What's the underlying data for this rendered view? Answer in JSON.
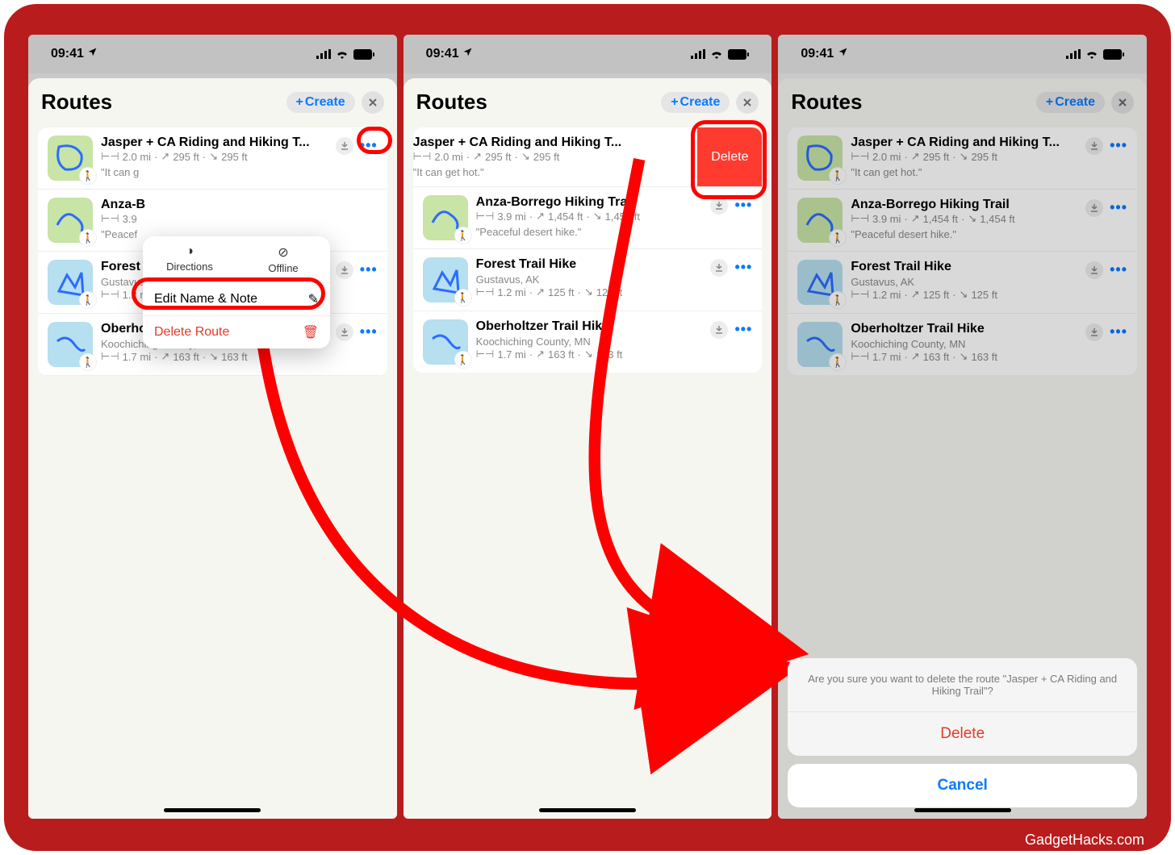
{
  "status": {
    "time": "09:41"
  },
  "header": {
    "title": "Routes",
    "create_label": "Create"
  },
  "routes": [
    {
      "title": "Jasper + CA Riding and Hiking T...",
      "subtitle": "",
      "distance": "2.0 mi",
      "elev_up": "295 ft",
      "elev_down": "295 ft",
      "note": "\"It can get hot.\"",
      "thumb": "green"
    },
    {
      "title": "Anza-Borrego Hiking Trail",
      "subtitle": "",
      "distance": "3.9 mi",
      "elev_up": "1,454 ft",
      "elev_down": "1,454 ft",
      "note": "\"Peaceful desert hike.\"",
      "thumb": "green"
    },
    {
      "title": "Forest Trail Hike",
      "subtitle": "Gustavus, AK",
      "distance": "1.2 mi",
      "elev_up": "125 ft",
      "elev_down": "125 ft",
      "note": "",
      "thumb": "blue"
    },
    {
      "title": "Oberholtzer Trail Hike",
      "subtitle": "Koochiching County, MN",
      "distance": "1.7 mi",
      "elev_up": "163 ft",
      "elev_down": "163 ft",
      "note": "",
      "thumb": "blue"
    }
  ],
  "context_menu": {
    "directions": "Directions",
    "offline": "Offline",
    "edit": "Edit Name & Note",
    "delete": "Delete Route"
  },
  "swipe": {
    "delete": "Delete"
  },
  "action_sheet": {
    "message": "Are you sure you want to delete the route \"Jasper + CA Riding and Hiking Trail\"?",
    "delete": "Delete",
    "cancel": "Cancel"
  },
  "watermark": "GadgetHacks.com",
  "phone1_notes": {
    "jasper_note_truncated": "\"It can g",
    "anza_title_truncated": "Anza-B",
    "anza_meta_truncated": "3.9",
    "anza_note_truncated": "\"Peacef"
  }
}
